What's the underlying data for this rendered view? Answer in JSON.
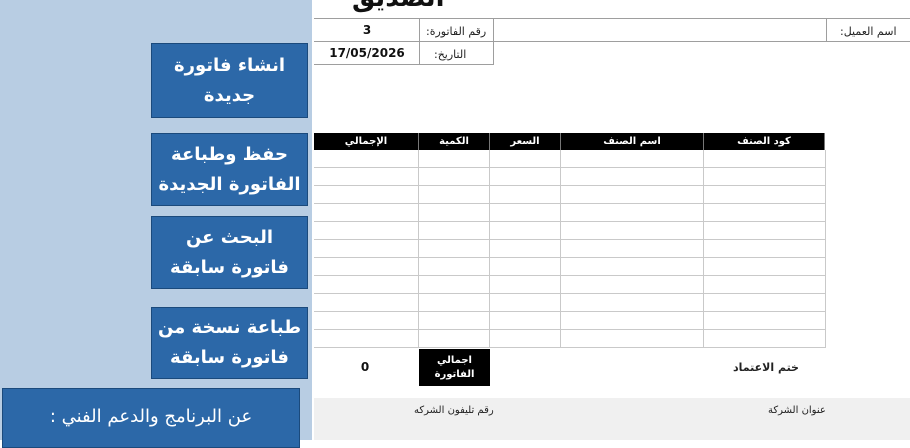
{
  "sidebar": {
    "buttons": [
      {
        "label": "انشاء فاتورة جديدة"
      },
      {
        "label": "حفظ وطباعة الفاتورة الجديدة"
      },
      {
        "label": "البحث عن فاتورة سابقة"
      },
      {
        "label": "طباعة نسخة من فاتورة سابقة"
      }
    ],
    "about_label": "عن البرنامج والدعم الفني :"
  },
  "invoice": {
    "logo_text": "الصديق",
    "invoice_number_label": "رقم الفاتورة:",
    "invoice_number": "3",
    "date_label": "التاريخ:",
    "date": "17/05/2026",
    "customer_label": "اسم العميل:",
    "customer_name": "",
    "columns": [
      "كود الصنف",
      "اسم الصنف",
      "السعر",
      "الكمية",
      "الإجمالي"
    ],
    "total_label": "اجمالي الفاتورة",
    "total_value": "0",
    "approval_label": "ختم الاعتماد",
    "company_address_label": "عنوان الشركة",
    "company_phone_label": "رقم تليفون الشركه"
  },
  "colors": {
    "sidebar_bg": "#b8cde3",
    "button_bg": "#2c68a8",
    "header_bg": "#000000"
  }
}
